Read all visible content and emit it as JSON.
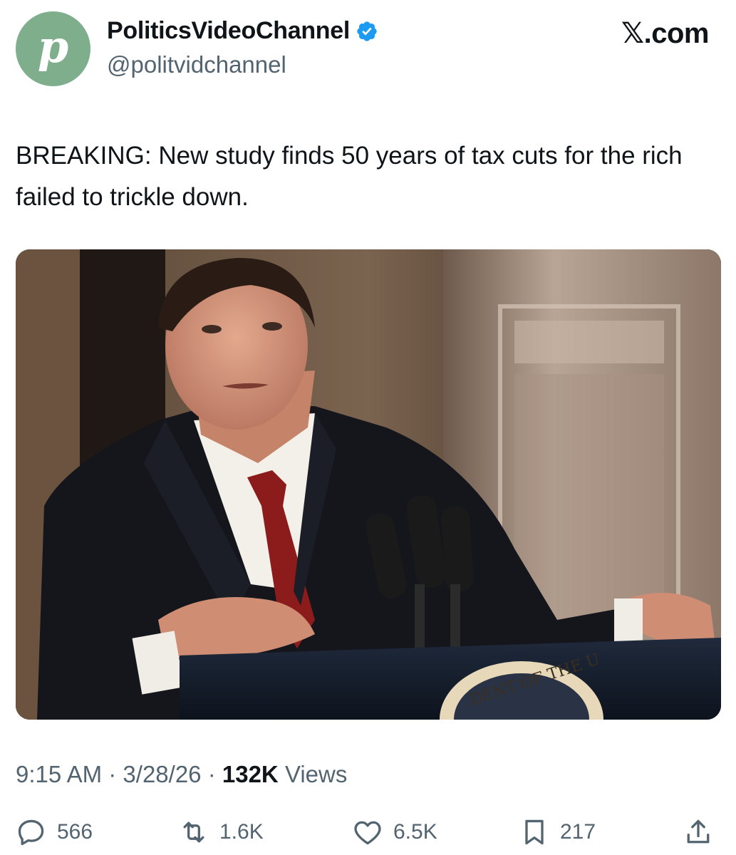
{
  "author": {
    "avatar_letter": "p",
    "display_name": "PoliticsVideoChannel",
    "handle": "@politvidchannel",
    "verified_color": "#1d9bf0"
  },
  "brand": "𝕏.com",
  "tweet": {
    "text": "BREAKING: New study finds 50 years of tax cuts for the rich failed to trickle down."
  },
  "photo": {
    "podium_seal_text": "DENT OF THE U"
  },
  "meta": {
    "time": "9:15 AM",
    "separator": "·",
    "date": "3/28/26",
    "views_count": "132K",
    "views_label": "Views"
  },
  "actions": {
    "replies": "566",
    "reposts": "1.6K",
    "likes": "6.5K",
    "bookmarks": "217"
  },
  "icons": {
    "reply": "reply-icon",
    "repost": "repost-icon",
    "like": "heart-icon",
    "bookmark": "bookmark-icon",
    "share": "share-icon"
  }
}
